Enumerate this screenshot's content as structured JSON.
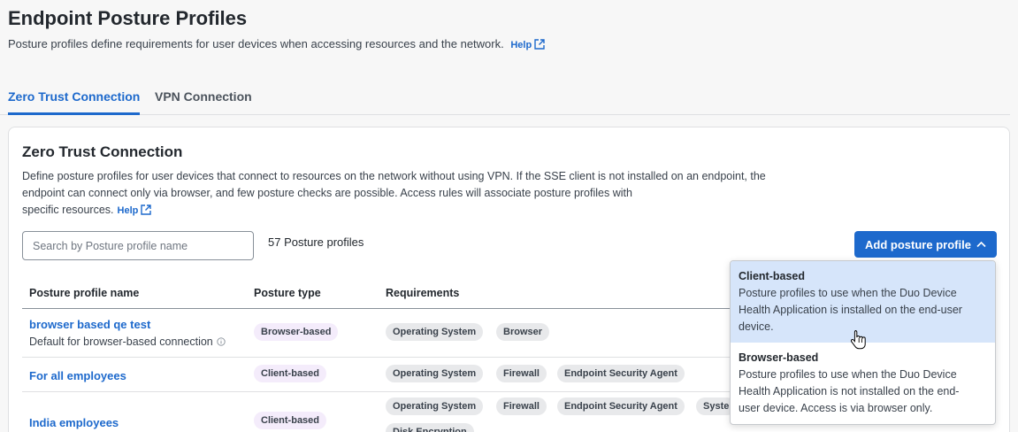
{
  "header": {
    "title": "Endpoint Posture Profiles",
    "description": "Posture profiles define requirements for user devices when accessing resources and the network.",
    "help_label": "Help"
  },
  "tabs": [
    {
      "label": "Zero Trust Connection",
      "active": true
    },
    {
      "label": "VPN Connection",
      "active": false
    }
  ],
  "section": {
    "title": "Zero Trust Connection",
    "description_lines": [
      "Define posture profiles for user devices that connect to resources on the network without using VPN. If the SSE client is not installed on an endpoint, the",
      "endpoint can connect only via browser, and few posture checks are possible. Access rules will associate posture profiles with",
      "specific resources."
    ],
    "help_label": "Help"
  },
  "search": {
    "placeholder": "Search by Posture profile name",
    "value": ""
  },
  "profile_count": "57 Posture profiles",
  "add_button": {
    "label": "Add posture profile"
  },
  "table": {
    "headers": [
      "Posture profile name",
      "Posture type",
      "Requirements"
    ],
    "rows": [
      {
        "name": "browser based qe test",
        "subtitle": "Default for browser-based connection",
        "type": "Browser-based",
        "requirements": [
          "Operating System",
          "Browser"
        ]
      },
      {
        "name": "For all employees",
        "subtitle": "",
        "type": "Client-based",
        "requirements": [
          "Operating System",
          "Firewall",
          "Endpoint Security Agent"
        ]
      },
      {
        "name": "India employees",
        "subtitle": "",
        "type": "Client-based",
        "requirements": [
          "Operating System",
          "Firewall",
          "Endpoint Security Agent",
          "Syste",
          "Disk Encryption"
        ]
      }
    ]
  },
  "dropdown": {
    "items": [
      {
        "title": "Client-based",
        "description_lines": [
          "Posture profiles to use when the Duo Device",
          "Health Application is installed on the end-user",
          "device."
        ],
        "highlighted": true
      },
      {
        "title": "Browser-based",
        "description_lines": [
          "Posture profiles to use when the Duo Device",
          "Health Application is not installed on the end-",
          "user device. Access is via browser only."
        ],
        "highlighted": false
      }
    ]
  },
  "colors": {
    "accent": "#1d69cc",
    "type_pill_bg": "#f4ecfb",
    "req_pill_bg": "#e8e9eb",
    "dropdown_highlight": "#d6e5fa"
  }
}
